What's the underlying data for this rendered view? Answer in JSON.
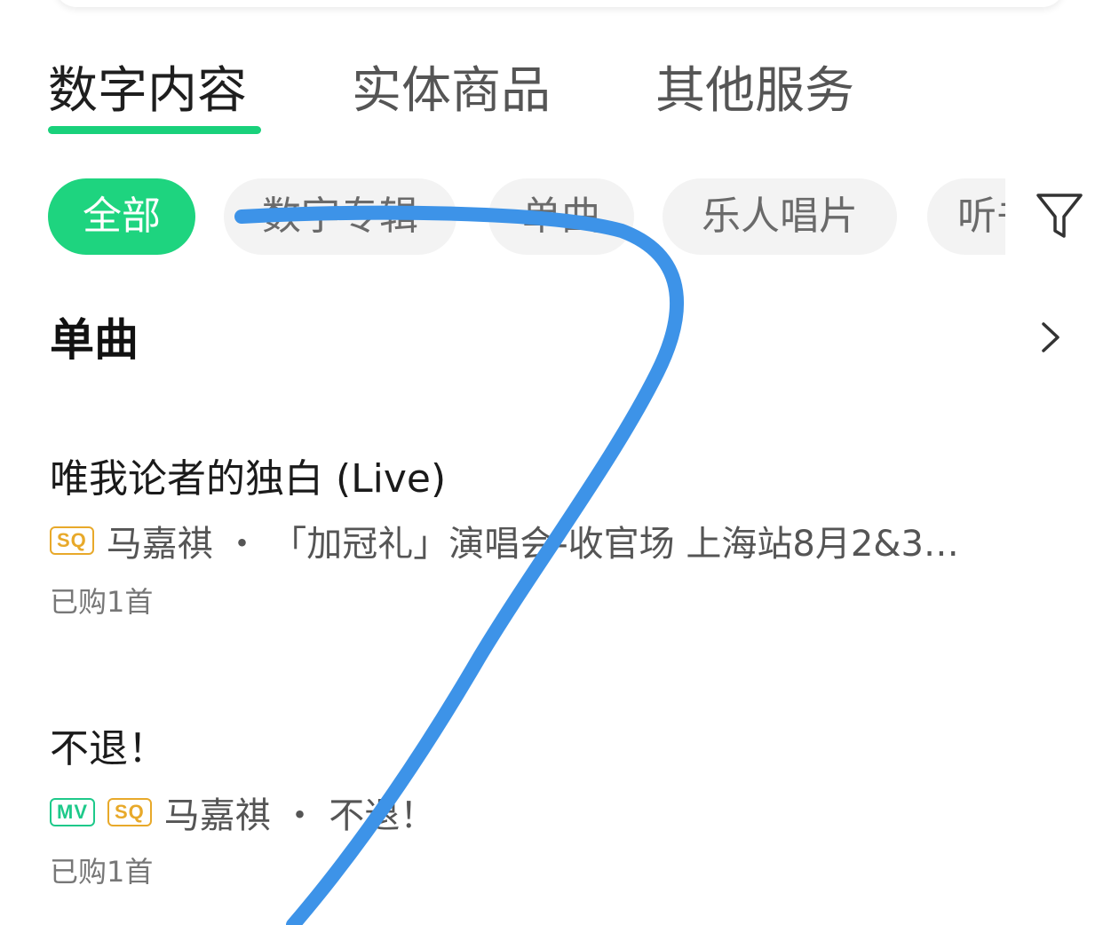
{
  "main_tabs": [
    {
      "label": "数字内容",
      "active": true
    },
    {
      "label": "实体商品",
      "active": false
    },
    {
      "label": "其他服务",
      "active": false
    }
  ],
  "chips": [
    {
      "label": "全部",
      "active": true
    },
    {
      "label": "数字专辑",
      "active": false
    },
    {
      "label": "单曲",
      "active": false
    },
    {
      "label": "乐人唱片",
      "active": false
    },
    {
      "label": "听书",
      "active": false
    }
  ],
  "filter_icon": "filter-icon",
  "section": {
    "title": "单曲",
    "more_icon": "chevron-right-icon"
  },
  "songs": [
    {
      "title": "唯我论者的独白 (Live)",
      "badges": [
        "SQ"
      ],
      "meta": "马嘉祺 ・ 「加冠礼」演唱会-收官场 上海站8月2&3…",
      "purchased": "已购1首"
    },
    {
      "title": "不退！",
      "badges": [
        "MV",
        "SQ"
      ],
      "meta": "马嘉祺 ・ 不退！",
      "purchased": "已购1首"
    }
  ],
  "colors": {
    "accent": "#1ed47f",
    "sq_badge": "#e8a92a",
    "mv_badge": "#1ec98a",
    "annotation_stroke": "#3d93e8"
  }
}
